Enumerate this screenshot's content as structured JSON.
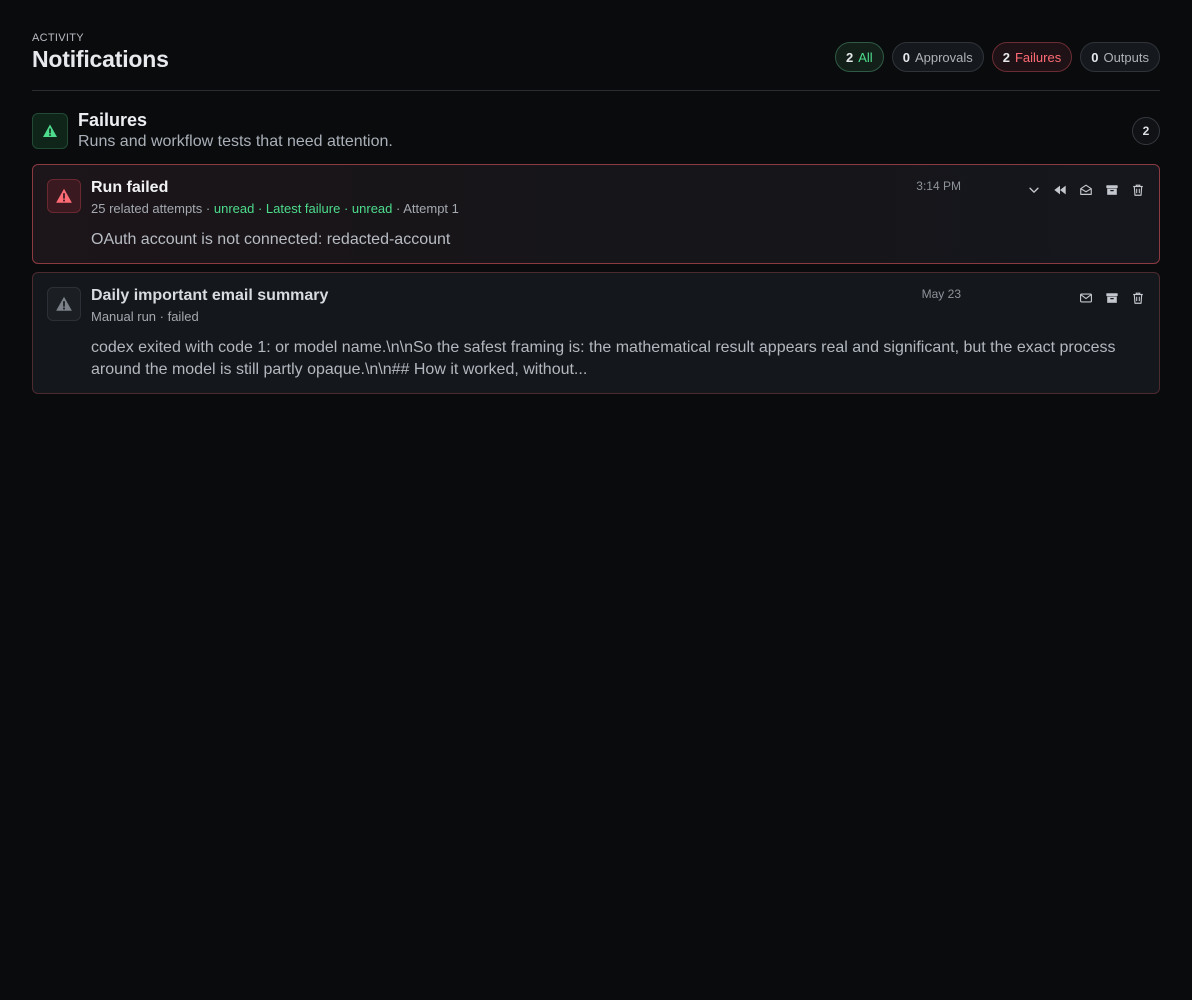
{
  "header": {
    "eyebrow": "ACTIVITY",
    "title": "Notifications"
  },
  "filters": [
    {
      "count": "2",
      "label": "All",
      "state": "active",
      "color": "#4ddc8c"
    },
    {
      "count": "0",
      "label": "Approvals"
    },
    {
      "count": "2",
      "label": "Failures",
      "color": "#ff6b75"
    },
    {
      "count": "0",
      "label": "Outputs"
    }
  ],
  "section": {
    "icon": "warning-icon",
    "title": "Failures",
    "subtitle": "Runs and workflow tests that need attention.",
    "count": "2"
  },
  "notifications": [
    {
      "icon": "warning-icon",
      "title": "Run failed",
      "meta": {
        "attempts": "25 related attempts",
        "sep1": " · ",
        "status1": "unread",
        "sep2": " · ",
        "latest": "Latest failure",
        "sep3": " · ",
        "status2": "unread",
        "sep4": " · ",
        "attempt": "Attempt 1"
      },
      "time": "3:14 PM",
      "message": "OAuth account is not connected: redacted-account",
      "actions": [
        "chevron-down-icon",
        "rewind-icon",
        "mail-open-icon",
        "archive-icon",
        "trash-icon"
      ]
    },
    {
      "icon": "warning-icon",
      "title": "Daily important email summary",
      "meta": {
        "text": "Manual run · failed"
      },
      "time": "May 23",
      "message": "codex exited with code 1: or model name.\\n\\nSo the safest framing is: the mathematical result appears real and significant, but the exact process around the model is still partly opaque.\\n\\n## How it worked, without...",
      "actions": [
        "mail-icon",
        "archive-icon",
        "trash-icon"
      ]
    }
  ],
  "colors": {
    "background": "#0a0b0d",
    "accent_green": "#4ddc8c",
    "accent_red": "#ff6b75",
    "card_border_red": "#8b3a42"
  }
}
